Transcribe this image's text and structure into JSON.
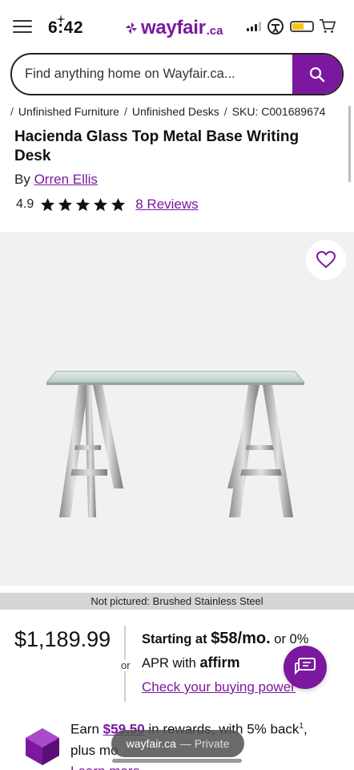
{
  "status_bar": {
    "time": "6:42"
  },
  "header": {
    "logo_text": "wayfair",
    "logo_suffix": ".ca",
    "brand_color": "#7b189f"
  },
  "search": {
    "placeholder": "Find anything home on Wayfair.ca..."
  },
  "breadcrumb": {
    "items": [
      "Unfinished Furniture",
      "Unfinished Desks"
    ],
    "sku": "SKU: C001689674"
  },
  "product": {
    "title": "Hacienda Glass Top Metal Base Writing Desk",
    "by_label": "By",
    "brand": "Orren Ellis",
    "rating": "4.9",
    "stars": 5,
    "reviews": "8 Reviews",
    "not_pictured": "Not pictured: Brushed Stainless Steel"
  },
  "pricing": {
    "price": "$1,189.99",
    "or": "or",
    "starting_at": "Starting at",
    "monthly": "$58/mo.",
    "or_zero": "or 0%",
    "apr_with": "APR with",
    "affirm": "affirm",
    "buying_power": "Check your buying power"
  },
  "rewards": {
    "earn": "Earn",
    "amount": "$59.50",
    "rest": "in rewards, with 5% back",
    "superscript": "1",
    "trail": ",",
    "line2": "plus mo",
    "learn_more": "Learn more"
  },
  "browser": {
    "domain": "wayfair.ca",
    "mode": "— Private"
  }
}
